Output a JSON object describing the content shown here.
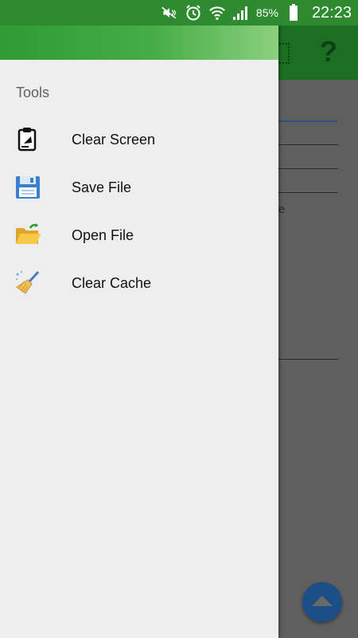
{
  "status_bar": {
    "battery": "85%",
    "time": "22:23",
    "icons": [
      "mute-vibrate-icon",
      "alarm-clock-icon",
      "wifi-icon",
      "signal-icon",
      "battery-icon"
    ]
  },
  "background_app": {
    "toolbar_icon": "?",
    "partial_text": "e"
  },
  "drawer": {
    "section_label": "Tools",
    "items": [
      {
        "label": "Clear Screen",
        "icon": "clipboard-icon"
      },
      {
        "label": "Save File",
        "icon": "floppy-disk-icon"
      },
      {
        "label": "Open File",
        "icon": "open-folder-icon"
      },
      {
        "label": "Clear Cache",
        "icon": "broom-icon"
      }
    ]
  },
  "colors": {
    "status_bar": "#2e8b2f",
    "toolbar": "#1b6e22",
    "drawer_bg": "#eeeeee",
    "fab": "#1c4f86"
  }
}
